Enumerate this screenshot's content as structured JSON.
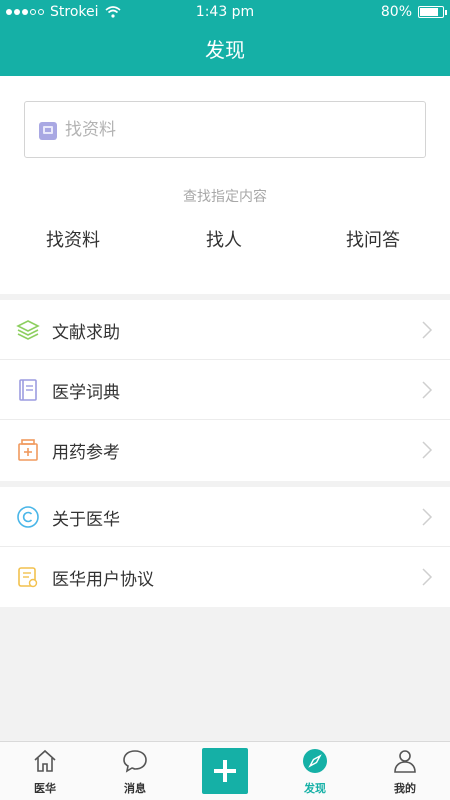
{
  "status_bar": {
    "carrier": "Strokei",
    "time": "1:43 pm",
    "battery": "80%",
    "battery_level": 0.8
  },
  "nav": {
    "title": "发现"
  },
  "search": {
    "placeholder": "找资料",
    "hint": "查找指定内容",
    "options": [
      "找资料",
      "找人",
      "找问答"
    ]
  },
  "menu_group_1": [
    {
      "label": "文献求助",
      "icon": "layers-icon",
      "color": "#8dcf5f"
    },
    {
      "label": "医学词典",
      "icon": "book-icon",
      "color": "#9c9ce0"
    },
    {
      "label": "用药参考",
      "icon": "medicine-icon",
      "color": "#f09a5e"
    }
  ],
  "menu_group_2": [
    {
      "label": "关于医华",
      "icon": "copyright-icon",
      "color": "#4ab6e8"
    },
    {
      "label": "医华用户协议",
      "icon": "document-icon",
      "color": "#f2c14e"
    }
  ],
  "tabbar": {
    "accent": "#15b0a6",
    "items": [
      {
        "label": "医华",
        "icon": "home-icon"
      },
      {
        "label": "消息",
        "icon": "chat-icon"
      },
      {
        "label": "",
        "icon": "plus-icon"
      },
      {
        "label": "发现",
        "icon": "compass-icon",
        "active": true
      },
      {
        "label": "我的",
        "icon": "person-icon"
      }
    ]
  }
}
